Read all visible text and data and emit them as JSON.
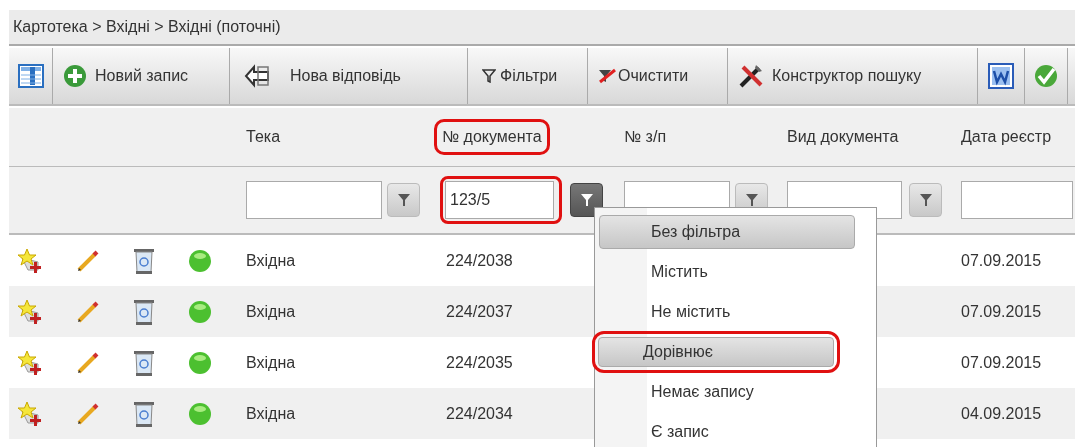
{
  "breadcrumb": "Картотека > Вхідні > Вхідні (поточні)",
  "toolbar": [
    {
      "kind": "columns"
    },
    {
      "kind": "add",
      "label": "Новий запис"
    },
    {
      "kind": "reply",
      "label": "Нова відповідь"
    },
    {
      "kind": "filter",
      "label": "Фільтри"
    },
    {
      "kind": "clear",
      "label": "Очистити"
    },
    {
      "kind": "tools",
      "label": "Конструктор пошуку"
    },
    {
      "kind": "word"
    },
    {
      "kind": "check"
    }
  ],
  "columns": [
    {
      "label": "Тека",
      "highlighted": false
    },
    {
      "label": "№ документа",
      "highlighted": true
    },
    {
      "label": "№ з/п",
      "highlighted": false
    },
    {
      "label": "Вид документа",
      "highlighted": false
    },
    {
      "label": "Дата реєстр",
      "highlighted": false
    }
  ],
  "filters": [
    {
      "kind": "with-button",
      "active": false,
      "highlighted": false
    },
    {
      "kind": "with-button",
      "value": "123/5",
      "active": true,
      "highlighted": true
    },
    {
      "kind": "with-button",
      "active": false,
      "highlighted": false
    },
    {
      "kind": "with-button",
      "active": false,
      "highlighted": false
    },
    {
      "kind": "plain",
      "highlighted": false
    }
  ],
  "rows": [
    {
      "folder": "Вхідна",
      "number": "224/2038",
      "date": "07.09.2015"
    },
    {
      "folder": "Вхідна",
      "number": "224/2037",
      "date": "07.09.2015"
    },
    {
      "folder": "Вхідна",
      "number": "224/2035",
      "date": "07.09.2015"
    },
    {
      "folder": "Вхідна",
      "number": "224/2034",
      "date": "04.09.2015"
    }
  ],
  "menu": {
    "items": [
      {
        "label": "Без фільтра",
        "selected": true,
        "highlighted": false
      },
      {
        "label": "Містить",
        "selected": false,
        "highlighted": false
      },
      {
        "label": "Не містить",
        "selected": false,
        "highlighted": false
      },
      {
        "label": "Дорівнює",
        "selected": true,
        "highlighted": true
      },
      {
        "label": "Немає запису",
        "selected": false,
        "highlighted": false
      },
      {
        "label": "Є запис",
        "selected": false,
        "highlighted": false
      }
    ]
  }
}
